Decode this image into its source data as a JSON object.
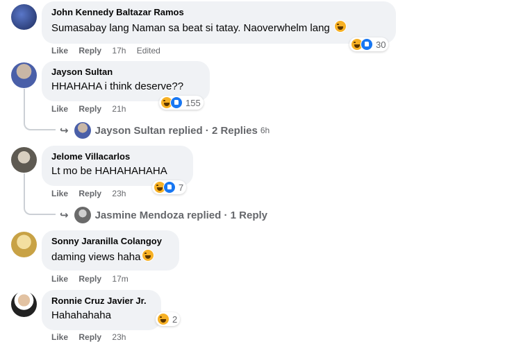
{
  "comments": [
    {
      "author": "John Kennedy Baltazar Ramos",
      "text": "Sumasabay lang Naman sa beat si tatay. Naoverwhelm lang",
      "like_label": "Like",
      "reply_label": "Reply",
      "time": "17h",
      "edited": "Edited",
      "reaction_count": "30",
      "avatar_color": "#2b3f7a"
    },
    {
      "author": "Jayson Sultan",
      "text": "HHAHAHA i think deserve??",
      "like_label": "Like",
      "reply_label": "Reply",
      "time": "21h",
      "reaction_count": "155",
      "avatar_color": "#3a4f9a",
      "replies": {
        "author": "Jayson Sultan",
        "label": "Jayson Sultan replied · 2 Replies",
        "time": "6h"
      }
    },
    {
      "author": "Jelome Villacarlos",
      "text": "Lt mo be HAHAHAHAHA",
      "like_label": "Like",
      "reply_label": "Reply",
      "time": "23h",
      "reaction_count": "7",
      "avatar_color": "#6e6a63",
      "replies": {
        "author": "Jasmine Mendoza",
        "label": "Jasmine Mendoza replied · 1 Reply"
      }
    },
    {
      "author": "Sonny Jaranilla Colangoy",
      "text": "daming views haha",
      "like_label": "Like",
      "reply_label": "Reply",
      "time": "17m",
      "avatar_color": "#d8b24a"
    },
    {
      "author": "Ronnie Cruz Javier Jr.",
      "text": "Hahahahaha",
      "like_label": "Like",
      "reply_label": "Reply",
      "time": "23h",
      "reaction_count": "2",
      "avatar_color": "#2a2a2a"
    }
  ],
  "colors": {
    "bubble": "#f0f2f5",
    "meta_text": "#65676b",
    "like_blue": "#1877f2",
    "haha_yellow": "#f7b125"
  }
}
